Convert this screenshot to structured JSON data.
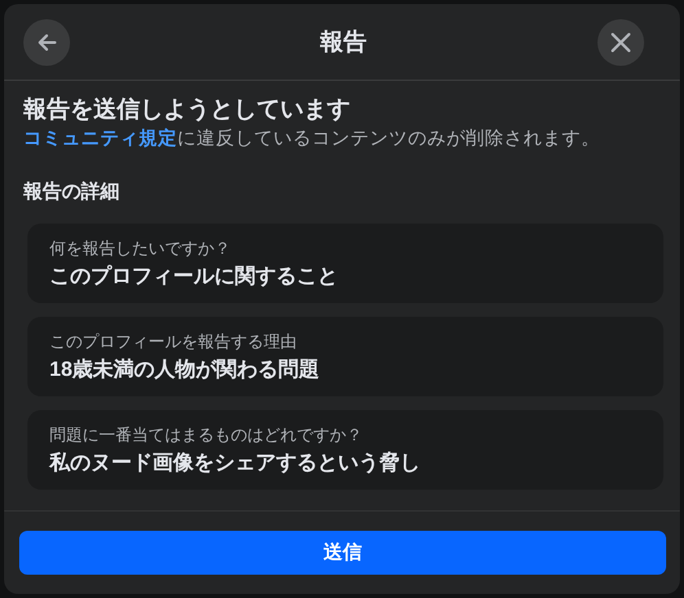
{
  "dialog": {
    "title": "報告"
  },
  "heading": "報告を送信しようとしています",
  "notice": {
    "link": "コミュニティ規定",
    "text": "に違反しているコンテンツのみが削除されます。"
  },
  "section_title": "報告の詳細",
  "details": [
    {
      "label": "何を報告したいですか？",
      "value": "このプロフィールに関すること"
    },
    {
      "label": "このプロフィールを報告する理由",
      "value": "18歳未満の人物が関わる問題"
    },
    {
      "label": "問題に一番当てはまるものはどれですか？",
      "value": "私のヌード画像をシェアするという脅し"
    }
  ],
  "submit_button": "送信"
}
